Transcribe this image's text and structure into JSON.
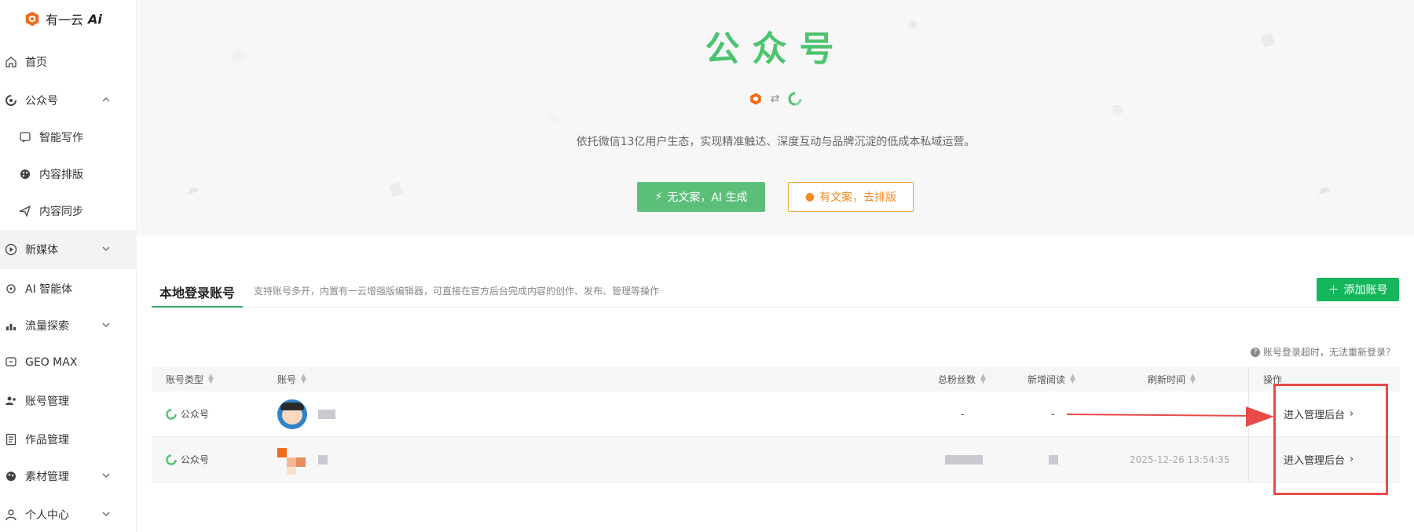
{
  "sidebar": {
    "logo_text": "有一云",
    "logo_ai": "Ai",
    "items": [
      {
        "label": "首页",
        "icon": "home-icon"
      },
      {
        "label": "公众号",
        "icon": "wechat-official-icon"
      },
      {
        "label": "智能写作",
        "icon": "write-icon"
      },
      {
        "label": "内容排版",
        "icon": "palette-icon"
      },
      {
        "label": "内容同步",
        "icon": "send-icon"
      },
      {
        "label": "新媒体",
        "icon": "play-icon"
      },
      {
        "label": "AI 智能体",
        "icon": "agent-icon"
      },
      {
        "label": "流量探索",
        "icon": "bar-chart-icon"
      },
      {
        "label": "GEO MAX",
        "icon": "geo-icon"
      },
      {
        "label": "账号管理",
        "icon": "users-icon"
      },
      {
        "label": "作品管理",
        "icon": "document-icon"
      },
      {
        "label": "素材管理",
        "icon": "material-icon"
      },
      {
        "label": "个人中心",
        "icon": "user-icon"
      }
    ]
  },
  "hero": {
    "title": "公众号",
    "subtitle": "依托微信13亿用户生态，实现精准触达、深度互动与品牌沉淀的低成本私域运营。",
    "btn_generate": "无文案，AI 生成",
    "btn_format": "有文案，去排版"
  },
  "accounts": {
    "tab_label": "本地登录账号",
    "tab_desc": "支持账号多开，内置有一云增强版编辑器，可直接在官方后台完成内容的创作、发布、管理等操作",
    "add_button": "添加账号",
    "tip": "账号登录超时，无法重新登录？",
    "columns": [
      "账号类型",
      "账号",
      "总粉丝数",
      "新增阅读",
      "刷新时间",
      "操作"
    ],
    "rows": [
      {
        "type": "公众号",
        "fans": "-",
        "reads": "-",
        "refresh": "",
        "action": "进入管理后台"
      },
      {
        "type": "公众号",
        "fans": "",
        "reads": "",
        "refresh": "2025-12-26 13:54:35",
        "action": "进入管理后台"
      }
    ]
  },
  "colors": {
    "brand_green": "#4cc36e",
    "add_green": "#16b75c",
    "orange": "#f08a24",
    "annotation_red": "#e84a4a"
  }
}
